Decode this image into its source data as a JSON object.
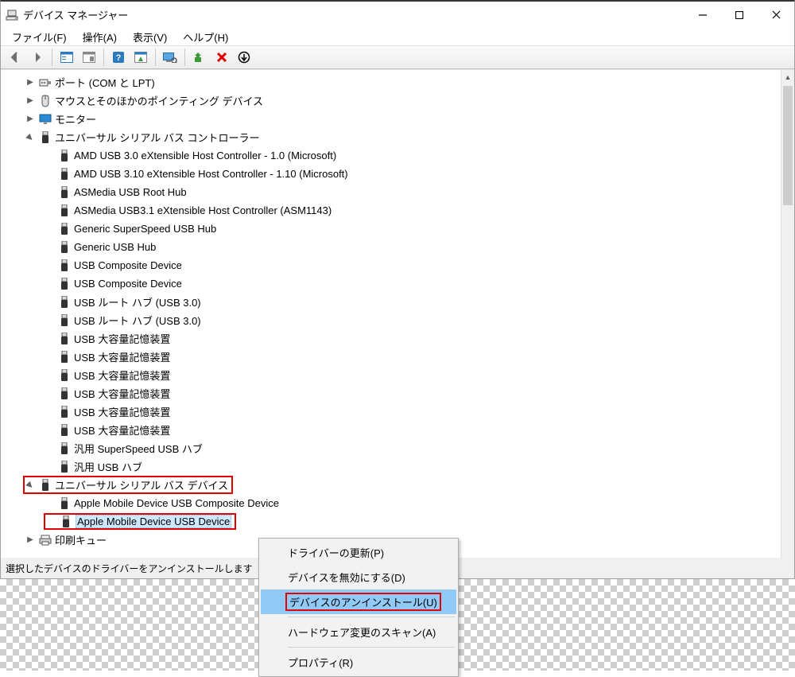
{
  "window": {
    "title": "デバイス マネージャー"
  },
  "menu": {
    "file": "ファイル(F)",
    "action": "操作(A)",
    "view": "表示(V)",
    "help": "ヘルプ(H)"
  },
  "status": {
    "text": "選択したデバイスのドライバーをアンインストールします"
  },
  "tree": {
    "ports": {
      "label": "ポート (COM と LPT)"
    },
    "mouse": {
      "label": "マウスとそのほかのポインティング デバイス"
    },
    "monitor": {
      "label": "モニター"
    },
    "usb_ctrl": {
      "label": "ユニバーサル シリアル バス コントローラー",
      "children": [
        "AMD USB 3.0 eXtensible Host Controller - 1.0 (Microsoft)",
        "AMD USB 3.10 eXtensible Host Controller - 1.10 (Microsoft)",
        "ASMedia USB Root Hub",
        "ASMedia USB3.1 eXtensible Host Controller (ASM1143)",
        "Generic SuperSpeed USB Hub",
        "Generic USB Hub",
        "USB Composite Device",
        "USB Composite Device",
        "USB ルート ハブ (USB 3.0)",
        "USB ルート ハブ (USB 3.0)",
        "USB 大容量記憶装置",
        "USB 大容量記憶装置",
        "USB 大容量記憶装置",
        "USB 大容量記憶装置",
        "USB 大容量記憶装置",
        "USB 大容量記憶装置",
        "汎用 SuperSpeed USB ハブ",
        "汎用 USB ハブ"
      ]
    },
    "usb_dev": {
      "label": "ユニバーサル シリアル バス デバイス",
      "children": [
        "Apple Mobile Device USB Composite Device",
        "Apple Mobile Device USB Device"
      ]
    },
    "print_queue": {
      "label": "印刷キュー"
    }
  },
  "context_menu": {
    "update": "ドライバーの更新(P)",
    "disable": "デバイスを無効にする(D)",
    "uninstall": "デバイスのアンインストール(U)",
    "scan": "ハードウェア変更のスキャン(A)",
    "properties": "プロパティ(R)"
  }
}
